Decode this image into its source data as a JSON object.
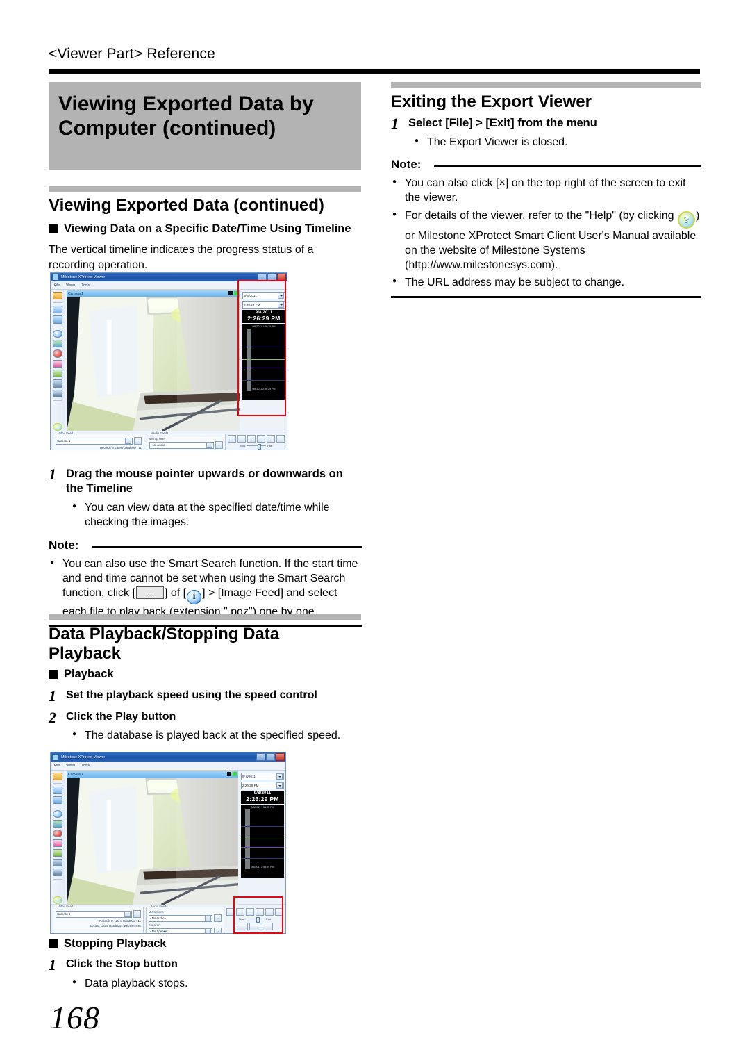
{
  "page": {
    "running_head": "<Viewer Part> Reference",
    "folio": "168"
  },
  "left_column": {
    "chapter_title_line1": "Viewing Exported Data by",
    "chapter_title_line2": "Computer (continued)",
    "section1": {
      "title": "Viewing Exported Data (continued)",
      "sub_head": "Viewing Data on a Specific Date/Time Using Timeline",
      "paragraph": "The vertical timeline indicates the progress status of a recording operation.",
      "step1_num": "1",
      "step1_text": "Drag the mouse pointer upwards or downwards on the Timeline",
      "step1_bullet": "You can view data at the specified date/time while checking the images.",
      "note_label": "Note:",
      "note_bullet_a": "You can also use the Smart Search function. If the start time and end time cannot be set when using the Smart Search function, click [",
      "note_inline_box": "..",
      "note_bullet_b": "] of [",
      "note_info_icon": "i",
      "note_bullet_c": "] > [Image Feed] and select each file to play back (extension \".pqz\") one by one."
    },
    "section2": {
      "title_line1": "Data Playback/Stopping Data",
      "title_line2": "Playback",
      "sub_head_playback": "Playback",
      "step1_num": "1",
      "step1_text": "Set the playback speed using the speed control",
      "step2_num": "2",
      "step2_text": "Click the Play button",
      "step2_bullet": "The database is played back at the specified speed.",
      "sub_head_stopping": "Stopping Playback",
      "stop_step_num": "1",
      "stop_step_text": "Click the Stop button",
      "stop_bullet": "Data playback stops."
    }
  },
  "right_column": {
    "title": "Exiting the Export Viewer",
    "step1_num": "1",
    "step1_text": "Select [File] > [Exit] from the menu",
    "step1_bullet": "The Export Viewer is closed.",
    "note_label": "Note:",
    "note_bullet_1": "You can also click [×] on the top right of the screen to exit the viewer.",
    "note_bullet_2a": "For details of the viewer, refer to the \"Help\" (by clicking",
    "note_help_icon": "?",
    "note_bullet_2b": ") or Milestone XProtect Smart Client User's Manual available on the website of Milestone Systems (http://www.milestonesys.com).",
    "note_bullet_3": "The URL address may be subject to change."
  },
  "screenshot": {
    "window_title": "Milestone XProtect Viewer",
    "menu": [
      "File",
      "Views",
      "Tools"
    ],
    "camera_title": "Camera 1",
    "date_value": "9/ 8/2011",
    "time_value": "2:26:29 PM",
    "clock_date": "9/8/2011",
    "clock_time": "2:26:29 PM",
    "timeline_top_label": "9/8/2011 1:56:25 PM",
    "timeline_bottom_label": "9/8/2011 2:56:29 PM",
    "video_feed_legend": "Video Feed",
    "video_feed_value": "Camera 1",
    "ellipsis_button": "..",
    "records_line": "Records In Latest Database : 11",
    "limit_line": "Limit In Latest Database : 24h:00m:00s",
    "audio_feeds_legend": "Audio Feeds",
    "microphone_label": "Microphone",
    "microphone_value": "- No Audio -",
    "speaker_label": "Speaker",
    "speaker_value": "- No Speaker -",
    "speed_label_slow": "Slow",
    "speed_label_fast": "Fast",
    "highlight_color": "#e30613",
    "led_colors": [
      "#101010",
      "#3ddb3d"
    ]
  }
}
